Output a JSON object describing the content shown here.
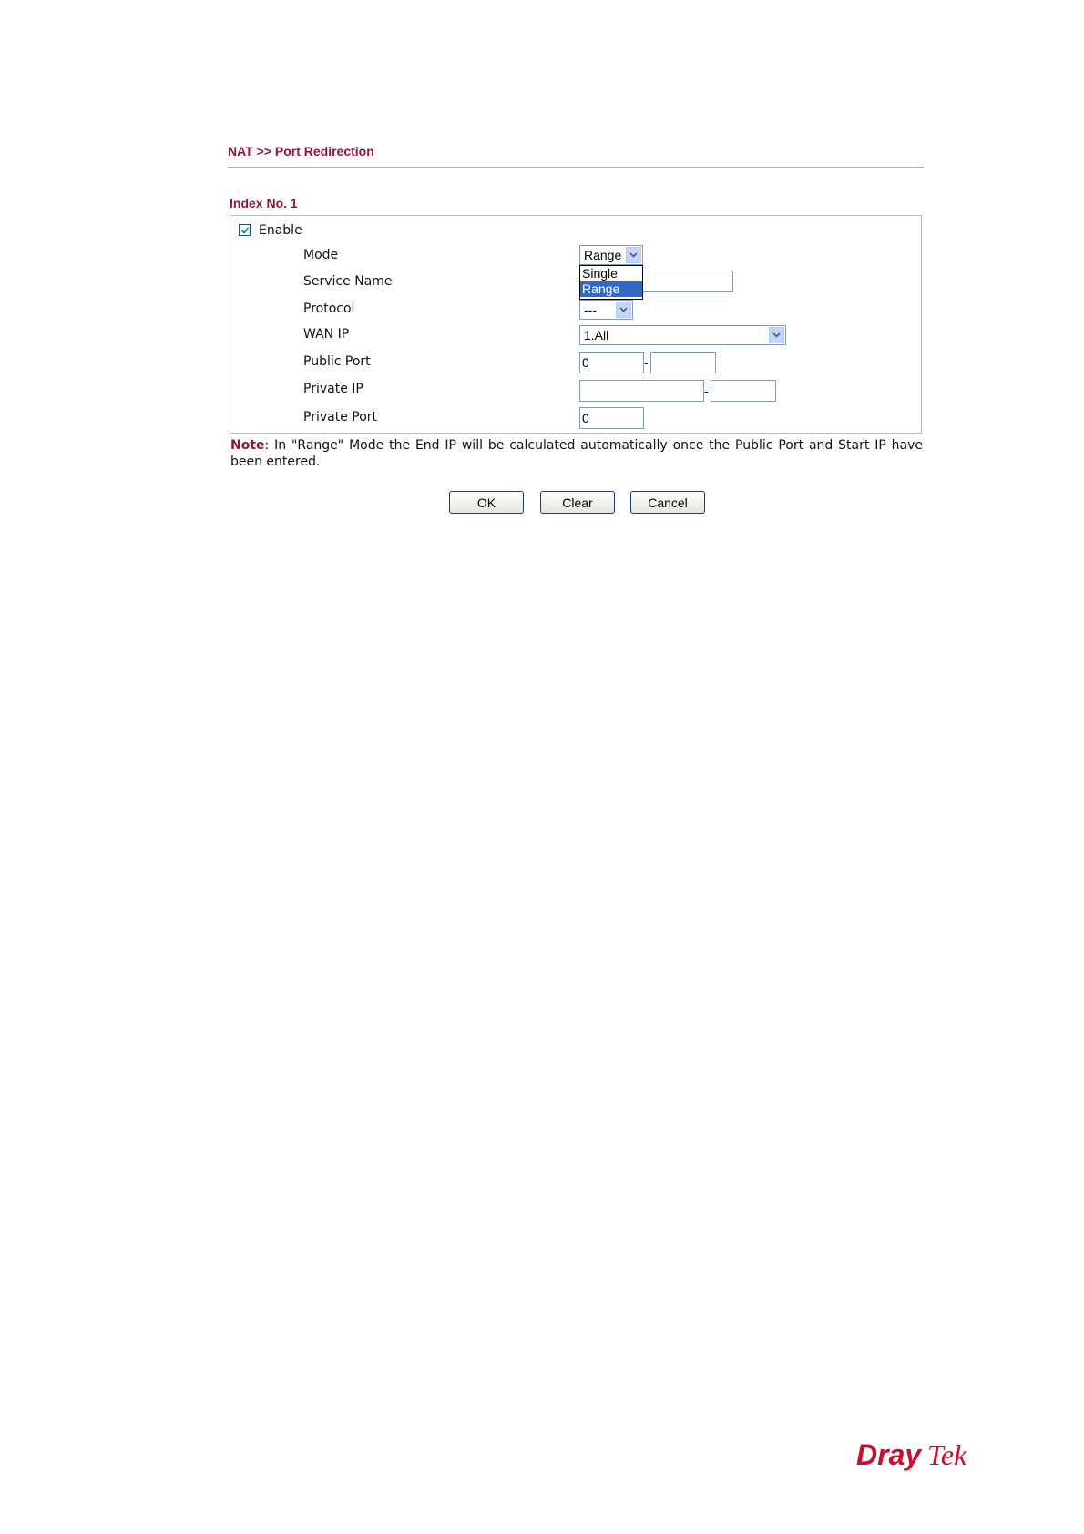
{
  "breadcrumb": "NAT >> Port Redirection",
  "index_label": "Index No. 1",
  "enable": {
    "label": "Enable",
    "checked": true
  },
  "fields": {
    "mode": {
      "label": "Mode",
      "value": "Range",
      "options": [
        "Single",
        "Range"
      ],
      "highlighted": "Range"
    },
    "service_name": {
      "label": "Service Name",
      "value": ""
    },
    "protocol": {
      "label": "Protocol",
      "value": "---"
    },
    "wan_ip": {
      "label": "WAN IP",
      "value": "1.All"
    },
    "public_port": {
      "label": "Public Port",
      "start": "0",
      "end": "",
      "separator": "-"
    },
    "private_ip": {
      "label": "Private IP",
      "start": "",
      "end": "",
      "separator": "-"
    },
    "private_port": {
      "label": "Private Port",
      "value": "0"
    }
  },
  "note": {
    "label": "Note",
    "text": ": In \"Range\" Mode the End IP will be calculated automatically once the Public Port and Start IP have been entered."
  },
  "buttons": {
    "ok": "OK",
    "clear": "Clear",
    "cancel": "Cancel"
  },
  "logo": {
    "text_dray": "Dray",
    "text_tek": "Tek",
    "color": "#c8102e"
  },
  "colors": {
    "accent": "#8b1a3a",
    "selection": "#316ac5",
    "input_border": "#7f9db9"
  }
}
